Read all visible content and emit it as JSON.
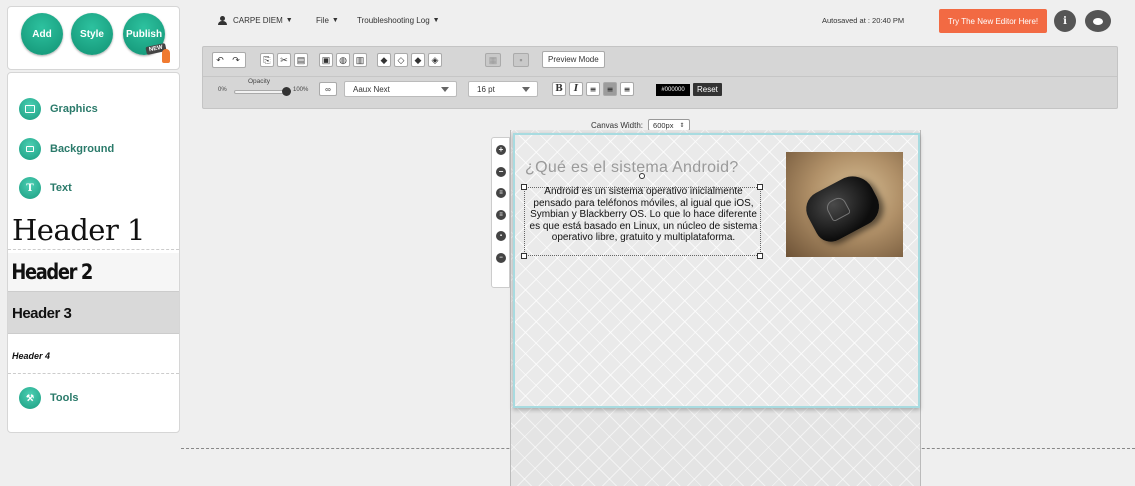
{
  "left_top": {
    "buttons": [
      {
        "label": "Add"
      },
      {
        "label": "Style"
      },
      {
        "label": "Publish",
        "badge": "NEW"
      }
    ]
  },
  "sidebar": {
    "items": [
      {
        "label": "Graphics",
        "icon": "image-icon"
      },
      {
        "label": "Background",
        "icon": "layers-icon"
      },
      {
        "label": "Text",
        "icon": "text-T-icon",
        "icon_glyph": "T"
      }
    ],
    "headers": [
      "Header 1",
      "Header 2",
      "Header 3",
      "Header 4"
    ],
    "tools": {
      "label": "Tools",
      "icon": "tools-icon"
    }
  },
  "topbar": {
    "user": "CARPE DIEM",
    "file": "File",
    "log": "Troubleshooting Log",
    "autosave": "Autosaved at : 20:40 PM",
    "try_button": "Try The New Editor Here!",
    "info_glyph": "i"
  },
  "toolbar": {
    "preview_label": "Preview Mode",
    "opacity_label": "Opacity",
    "opacity_min": "0%",
    "opacity_max": "100%",
    "opacity_value": 100,
    "font_family": "Aaux Next",
    "font_size": "16 pt",
    "bold_glyph": "B",
    "italic_glyph": "I",
    "color_value": "#000000",
    "reset_label": "Reset"
  },
  "canvas": {
    "width_label": "Canvas Width:",
    "width_value": "600px",
    "title": "¿Qué es el sistema Android?",
    "body": "Android es un sistema operativo inicialmente pensado para teléfonos móviles, al igual que iOS, Symbian y Blackberry OS. Lo que lo hace diferente es que está basado en Linux, un núcleo de sistema operativo libre, gratuito y multiplataforma."
  },
  "colors": {
    "accent_green": "#1aa589",
    "try_orange": "#f26a43",
    "canvas_border": "#a8dbe0"
  }
}
